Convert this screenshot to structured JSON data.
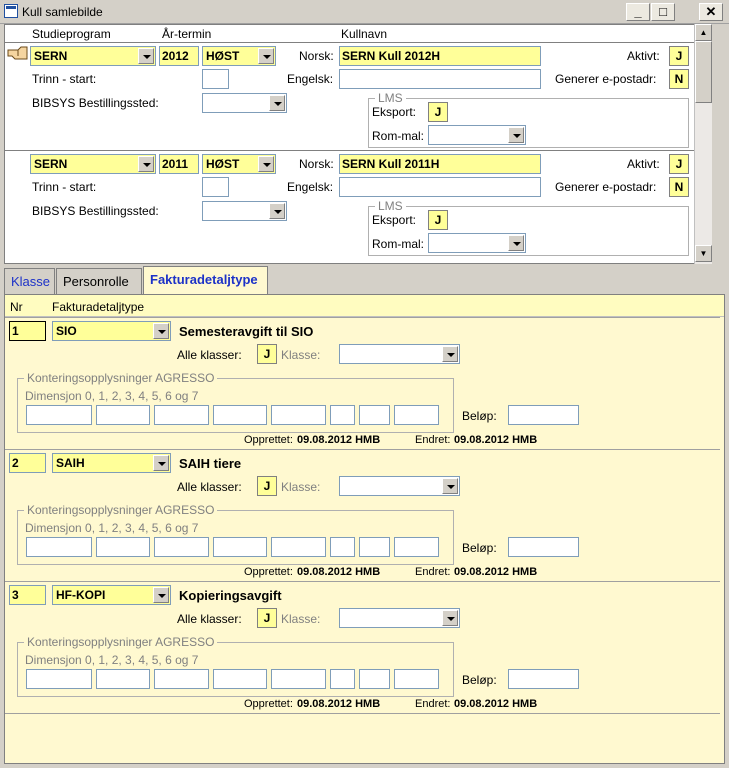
{
  "window": {
    "title": "Kull samlebilde",
    "min": "_",
    "max": "□",
    "close": "✕"
  },
  "upper": {
    "headers": {
      "studieprogram": "Studieprogram",
      "artermin": "År-termin",
      "kullnavn": "Kullnavn"
    },
    "labels": {
      "norsk": "Norsk:",
      "engelsk": "Engelsk:",
      "aktivt": "Aktivt:",
      "generer": "Generer e-postadr:",
      "trinn": "Trinn - start:",
      "bibsys": "BIBSYS Bestillingssted:",
      "lms": "LMS",
      "eksport": "Eksport:",
      "rommal": "Rom-mal:"
    },
    "records": [
      {
        "studieprogram": "SERN",
        "ar": "2012",
        "termin": "HØST",
        "norsk": "SERN Kull 2012H",
        "engelsk": "",
        "aktivt": "J",
        "generer": "N",
        "trinn": "",
        "bibsys": "",
        "eksport": "J",
        "rommal": ""
      },
      {
        "studieprogram": "SERN",
        "ar": "2011",
        "termin": "HØST",
        "norsk": "SERN Kull 2011H",
        "engelsk": "",
        "aktivt": "J",
        "generer": "N",
        "trinn": "",
        "bibsys": "",
        "eksport": "J",
        "rommal": ""
      }
    ]
  },
  "tabs": [
    "Klasse",
    "Personrolle",
    "Fakturadetaljtype"
  ],
  "lower": {
    "headers": {
      "nr": "Nr",
      "type": "Fakturadetaljtype"
    },
    "labels": {
      "alle": "Alle klasser:",
      "klasse": "Klasse:",
      "kont": "Konteringsopplysninger  AGRESSO",
      "dim": "Dimensjon 0, 1, 2, 3, 4, 5, 6 og 7",
      "belop": "Beløp:",
      "opprettet": "Opprettet:",
      "endret": "Endret:"
    },
    "records": [
      {
        "nr": "1",
        "code": "SIO",
        "desc": "Semesteravgift til SIO",
        "alle": "J",
        "klasse": "",
        "belop": "",
        "opprettet": "09.08.2012  HMB",
        "endret": "09.08.2012  HMB"
      },
      {
        "nr": "2",
        "code": "SAIH",
        "desc": "SAIH tiere",
        "alle": "J",
        "klasse": "",
        "belop": "",
        "opprettet": "09.08.2012  HMB",
        "endret": "09.08.2012  HMB"
      },
      {
        "nr": "3",
        "code": "HF-KOPI",
        "desc": "Kopieringsavgift",
        "alle": "J",
        "klasse": "",
        "belop": "",
        "opprettet": "09.08.2012  HMB",
        "endret": "09.08.2012  HMB"
      }
    ]
  }
}
